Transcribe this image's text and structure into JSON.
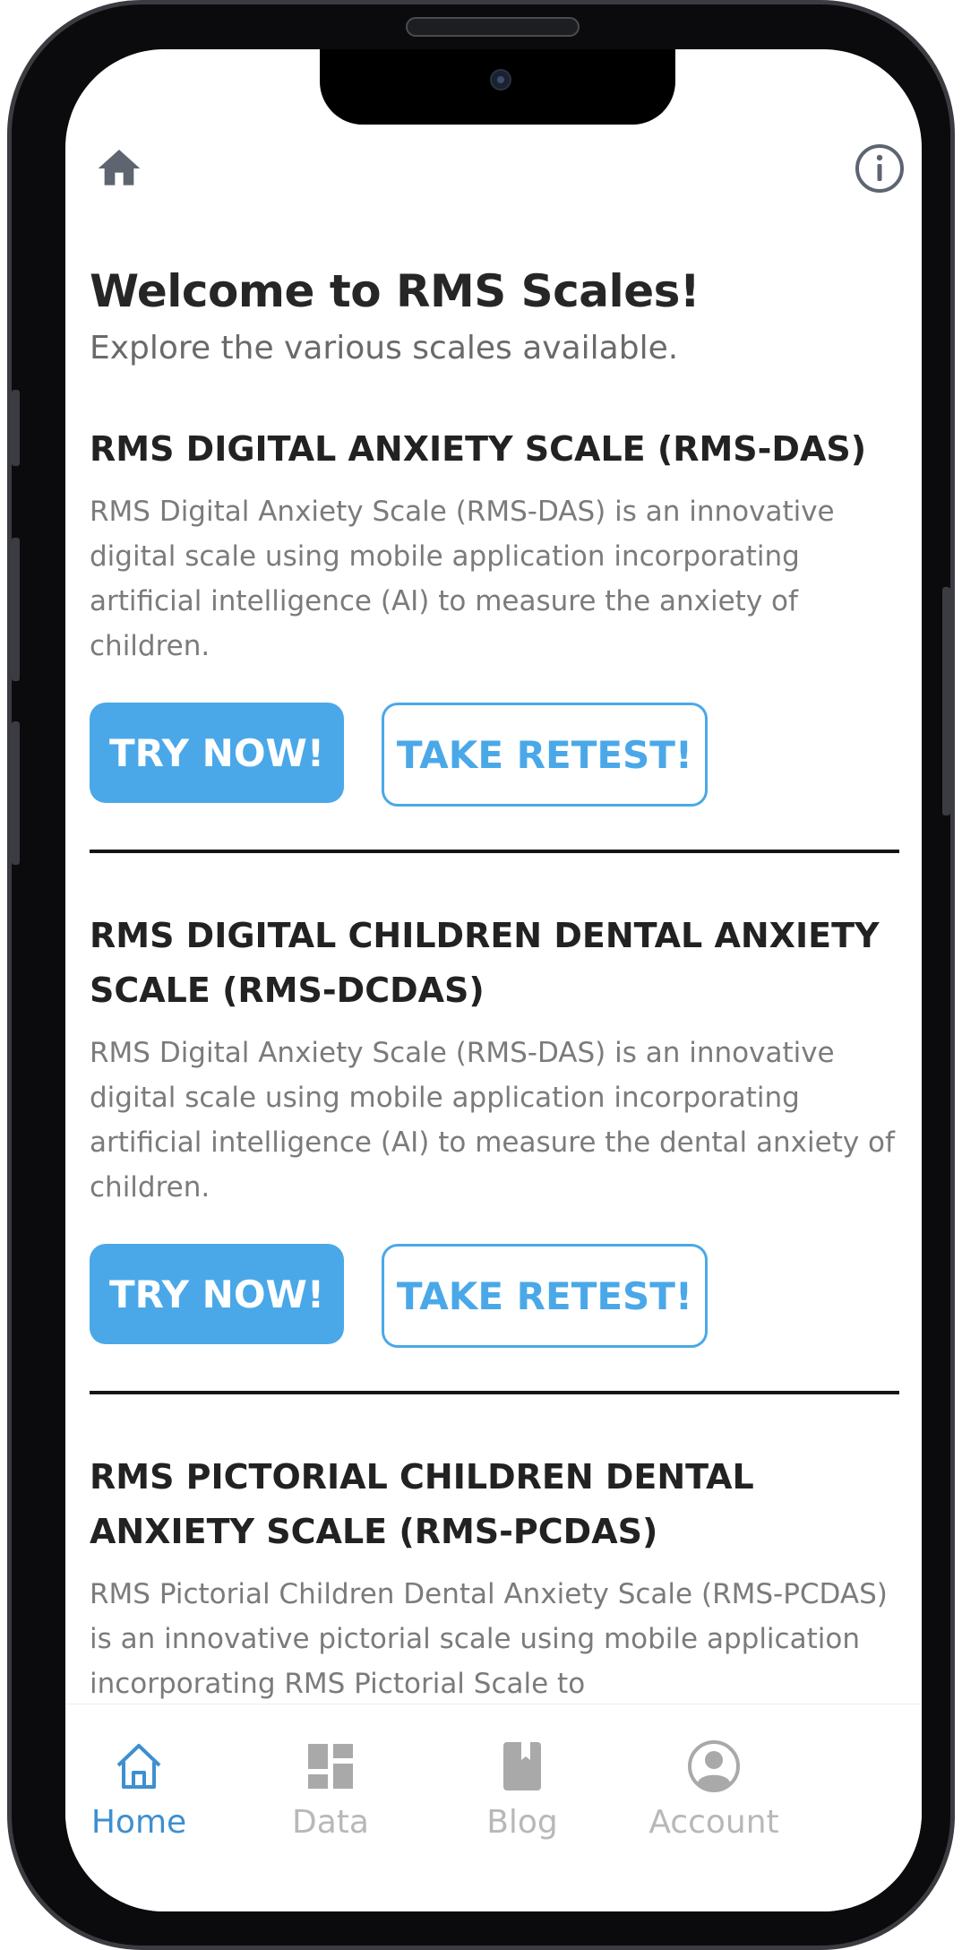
{
  "header": {
    "home_icon": "home-icon",
    "info_icon": "info-icon"
  },
  "welcome": {
    "title": "Welcome to RMS Scales!",
    "subtitle": "Explore the various scales available."
  },
  "scales": [
    {
      "title": "RMS DIGITAL ANXIETY SCALE (RMS-DAS)",
      "description": "RMS Digital Anxiety Scale (RMS-DAS) is an innovative digital scale using mobile application incorporating artificial intelligence (AI) to measure the anxiety of children.",
      "try_label": "TRY NOW!",
      "retest_label": "TAKE RETEST!"
    },
    {
      "title": "RMS DIGITAL CHILDREN DENTAL ANXIETY SCALE (RMS-DCDAS)",
      "description": "RMS Digital Anxiety Scale (RMS-DAS) is an innovative digital scale using mobile application incorporating artificial intelligence (AI) to measure the dental anxiety of children.",
      "try_label": "TRY NOW!",
      "retest_label": "TAKE RETEST!"
    },
    {
      "title": "RMS PICTORIAL CHILDREN DENTAL ANXIETY SCALE (RMS-PCDAS)",
      "description": "RMS Pictorial Children Dental Anxiety Scale (RMS-PCDAS) is an innovative pictorial scale using mobile application incorporating RMS Pictorial Scale to"
    }
  ],
  "tabs": [
    {
      "label": "Home",
      "icon": "home-outline-icon",
      "active": true
    },
    {
      "label": "Data",
      "icon": "dashboard-icon",
      "active": false
    },
    {
      "label": "Blog",
      "icon": "book-icon",
      "active": false
    },
    {
      "label": "Account",
      "icon": "account-circle-icon",
      "active": false
    }
  ],
  "colors": {
    "accent": "#4aa8e8",
    "active_tab": "#3d8fd0",
    "inactive_tab": "#b8b8b8",
    "title_text": "#222222",
    "body_text": "#7b7b7b"
  }
}
